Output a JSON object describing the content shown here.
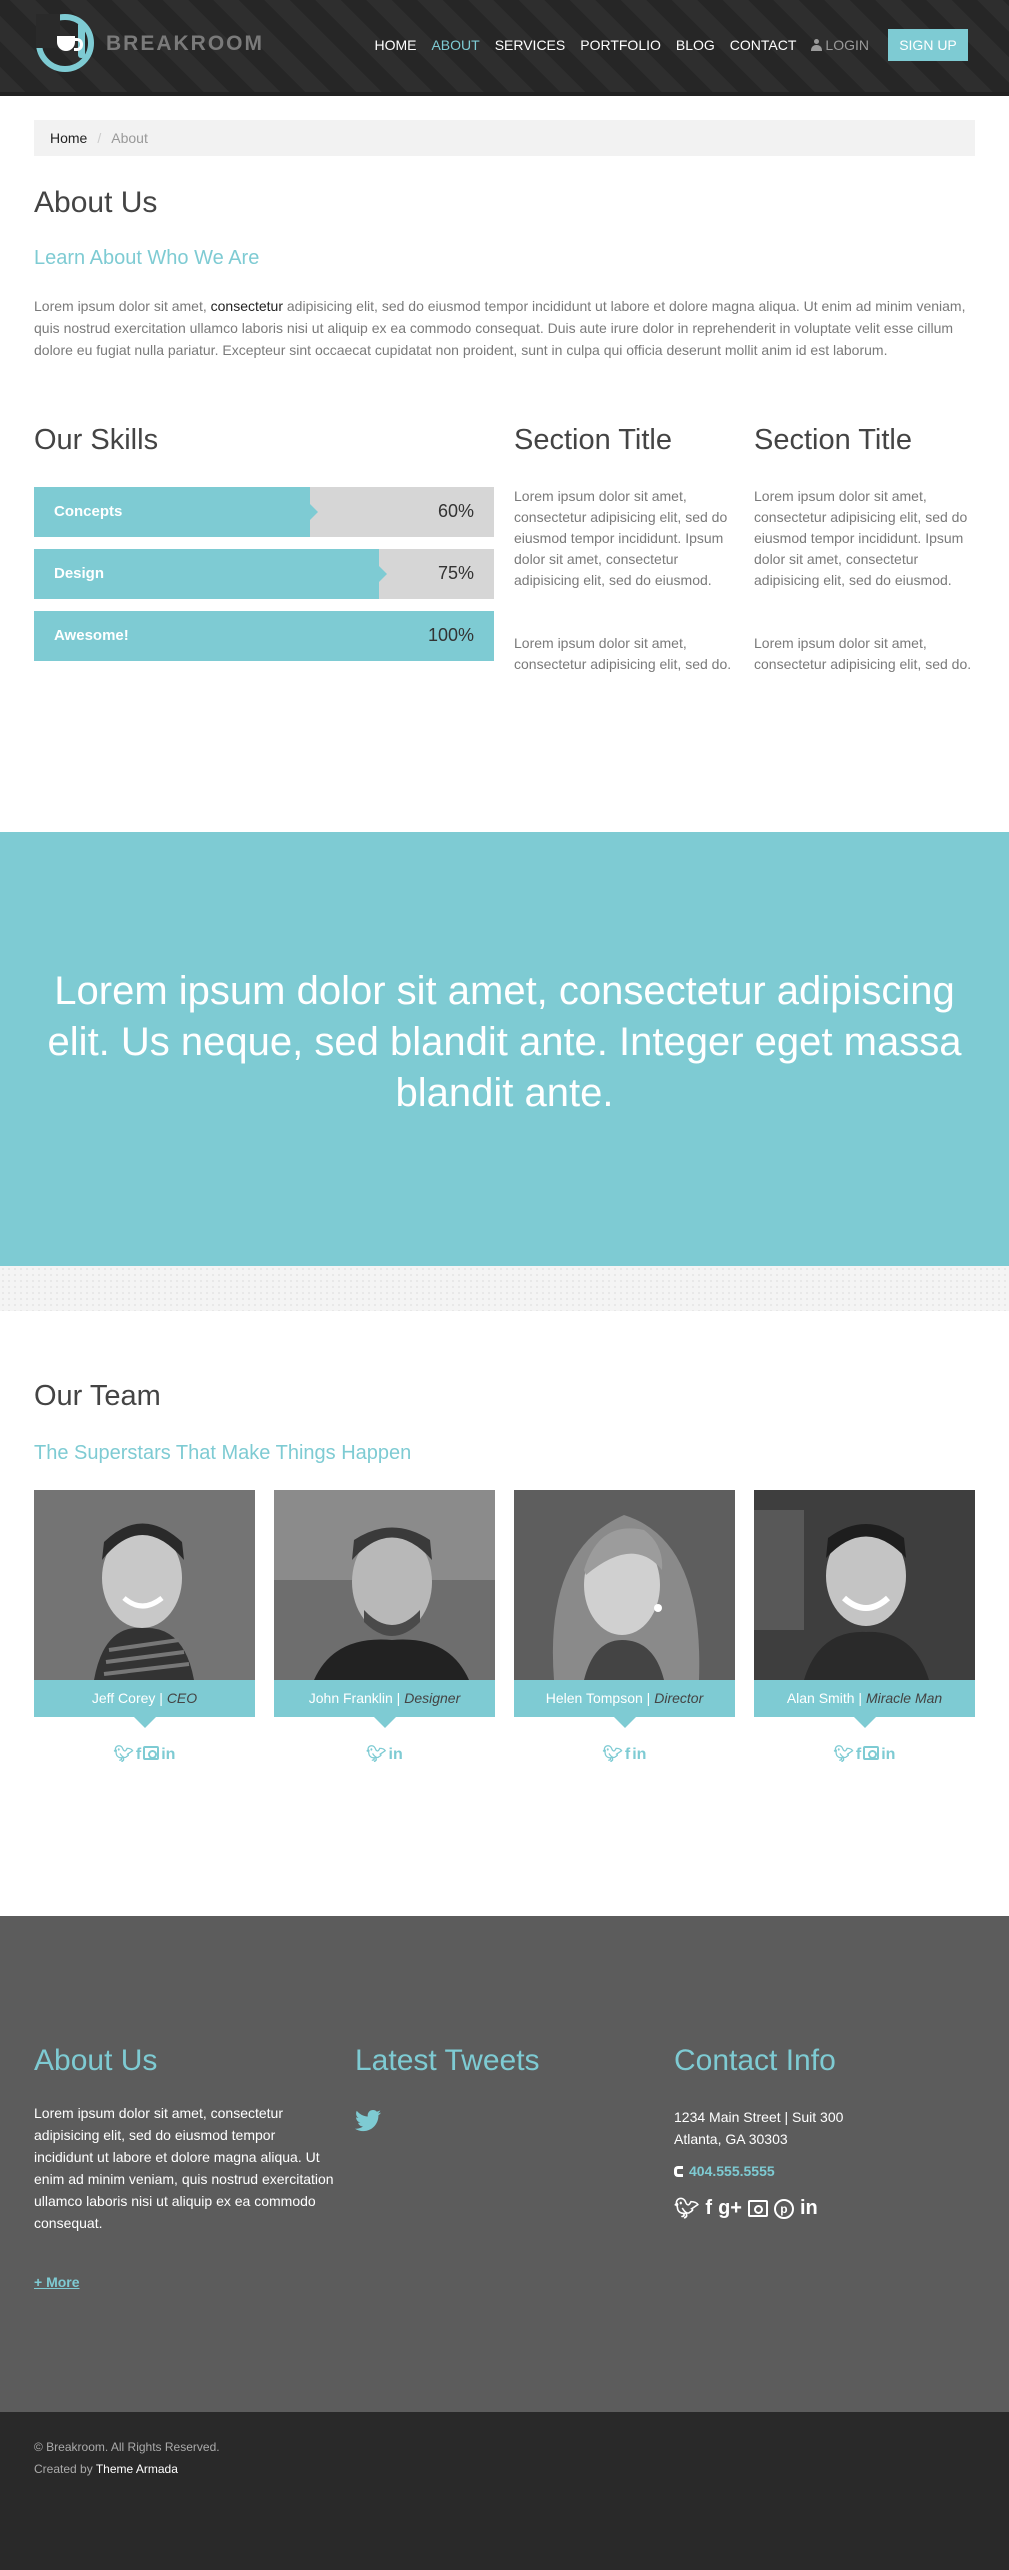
{
  "header": {
    "brand": "BREAKROOM",
    "nav": [
      "HOME",
      "ABOUT",
      "SERVICES",
      "PORTFOLIO",
      "BLOG",
      "CONTACT"
    ],
    "active_nav": "ABOUT",
    "login": "LOGIN",
    "signup": "SIGN UP"
  },
  "breadcrumb": {
    "home": "Home",
    "current": "About"
  },
  "about": {
    "title": "About Us",
    "subtitle": "Learn About Who We Are",
    "text_before": "Lorem ipsum dolor sit amet, ",
    "text_highlight": "consectetur",
    "text_after": " adipisicing elit, sed do eiusmod tempor incididunt ut labore et dolore magna aliqua. Ut enim ad minim veniam, quis nostrud exercitation ullamco laboris nisi ut aliquip ex ea commodo consequat. Duis aute irure dolor in reprehenderit in voluptate velit esse cillum dolore eu fugiat nulla pariatur. Excepteur sint occaecat cupidatat non proident, sunt in culpa qui officia deserunt mollit anim id est laborum."
  },
  "skills": {
    "title": "Our Skills",
    "items": [
      {
        "label": "Concepts",
        "percent_text": "60%",
        "value": 0.6
      },
      {
        "label": "Design",
        "percent_text": "75%",
        "value": 0.75
      },
      {
        "label": "Awesome!",
        "percent_text": "100%",
        "value": 1.0
      }
    ]
  },
  "sections": [
    {
      "title": "Section Title",
      "p1": "Lorem ipsum dolor sit amet, consectetur adipisicing elit, sed do eiusmod tempor incididunt. Ipsum dolor sit amet, consectetur adipisicing elit, sed do eiusmod.",
      "p2": "Lorem ipsum dolor sit amet, consectetur adipisicing elit, sed do."
    },
    {
      "title": "Section Title",
      "p1": "Lorem ipsum dolor sit amet, consectetur adipisicing elit, sed do eiusmod tempor incididunt. Ipsum dolor sit amet, consectetur adipisicing elit, sed do eiusmod.",
      "p2": "Lorem ipsum dolor sit amet, consectetur adipisicing elit, sed do."
    }
  ],
  "banner": {
    "text": "Lorem ipsum dolor sit amet, consectetur adipiscing elit. Us neque, sed blandit ante. Integer eget massa blandit ante."
  },
  "team": {
    "title": "Our Team",
    "subtitle": "The Superstars That Make Things Happen",
    "members": [
      {
        "name": "Jeff Corey",
        "role": "CEO",
        "socials": [
          "twitter-icon",
          "facebook-icon",
          "instagram-icon",
          "linkedin-icon"
        ]
      },
      {
        "name": "John Franklin",
        "role": "Designer",
        "socials": [
          "twitter-icon",
          "linkedin-icon"
        ]
      },
      {
        "name": "Helen Tompson",
        "role": "Director",
        "socials": [
          "twitter-icon",
          "facebook-icon",
          "linkedin-icon"
        ]
      },
      {
        "name": "Alan Smith",
        "role": "Miracle Man",
        "socials": [
          "twitter-icon",
          "facebook-icon",
          "instagram-icon",
          "linkedin-icon"
        ]
      }
    ]
  },
  "footer": {
    "about_title": "About Us",
    "about_text": "Lorem ipsum dolor sit amet, consectetur adipisicing elit, sed do eiusmod tempor incididunt ut labore et dolore magna aliqua. Ut enim ad minim veniam, quis nostrud exercitation ullamco laboris nisi ut aliquip ex ea commodo consequat.",
    "more": "+ More",
    "tweets_title": "Latest Tweets",
    "contact_title": "Contact Info",
    "address_line1": "1234 Main Street | Suit 300",
    "address_line2": "Atlanta, GA 30303",
    "phone": "404.555.5555",
    "contact_socials": [
      "twitter-icon",
      "facebook-icon",
      "google-plus-icon",
      "instagram-icon",
      "pinterest-icon",
      "linkedin-icon"
    ]
  },
  "bottom": {
    "copyright": "© Breakroom. All Rights Reserved.",
    "credit_prefix": "Created by ",
    "credit_name": "Theme Armada"
  },
  "colors": {
    "accent": "#7ecbd3",
    "header_bg": "#2a2a2a",
    "footer_bg": "#5c5c5c",
    "bottom_bg": "#292929"
  }
}
